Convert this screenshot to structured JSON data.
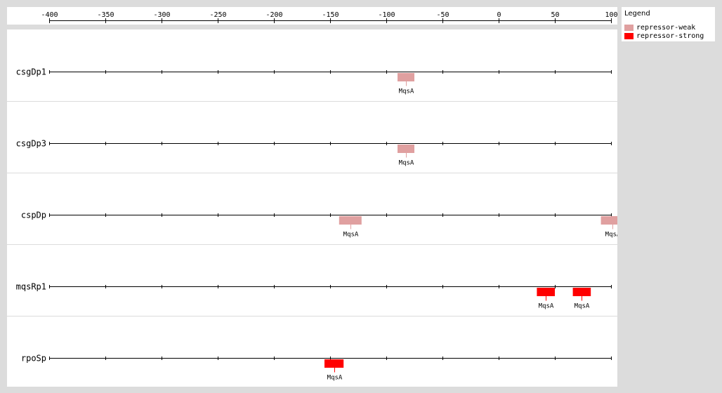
{
  "legend": {
    "title": "Legend",
    "items": [
      {
        "label": "repressor-weak",
        "color": "#e0a0a0"
      },
      {
        "label": "repressor-strong",
        "color": "#ff0000"
      }
    ]
  },
  "axis": {
    "min": -400,
    "max": 100,
    "step": 50,
    "ticks": [
      -400,
      -350,
      -300,
      -250,
      -200,
      -150,
      -100,
      -50,
      0,
      50,
      100
    ]
  },
  "tracks": [
    {
      "name": "csgDp1",
      "sites": [
        {
          "label": "MqsA",
          "start": -90,
          "end": -75,
          "type": "repressor-weak"
        }
      ]
    },
    {
      "name": "csgDp3",
      "sites": [
        {
          "label": "MqsA",
          "start": -90,
          "end": -75,
          "type": "repressor-weak"
        }
      ]
    },
    {
      "name": "cspDp",
      "sites": [
        {
          "label": "MqsA",
          "start": -142,
          "end": -122,
          "type": "repressor-weak"
        },
        {
          "label": "MqsA",
          "start": 91,
          "end": 111,
          "type": "repressor-weak"
        }
      ]
    },
    {
      "name": "mqsRp1",
      "sites": [
        {
          "label": "MqsA",
          "start": 34,
          "end": 50,
          "type": "repressor-strong"
        },
        {
          "label": "MqsA",
          "start": 66,
          "end": 82,
          "type": "repressor-strong"
        }
      ]
    },
    {
      "name": "rpoSp",
      "sites": [
        {
          "label": "MqsA",
          "start": -155,
          "end": -138,
          "type": "repressor-strong"
        }
      ]
    }
  ]
}
